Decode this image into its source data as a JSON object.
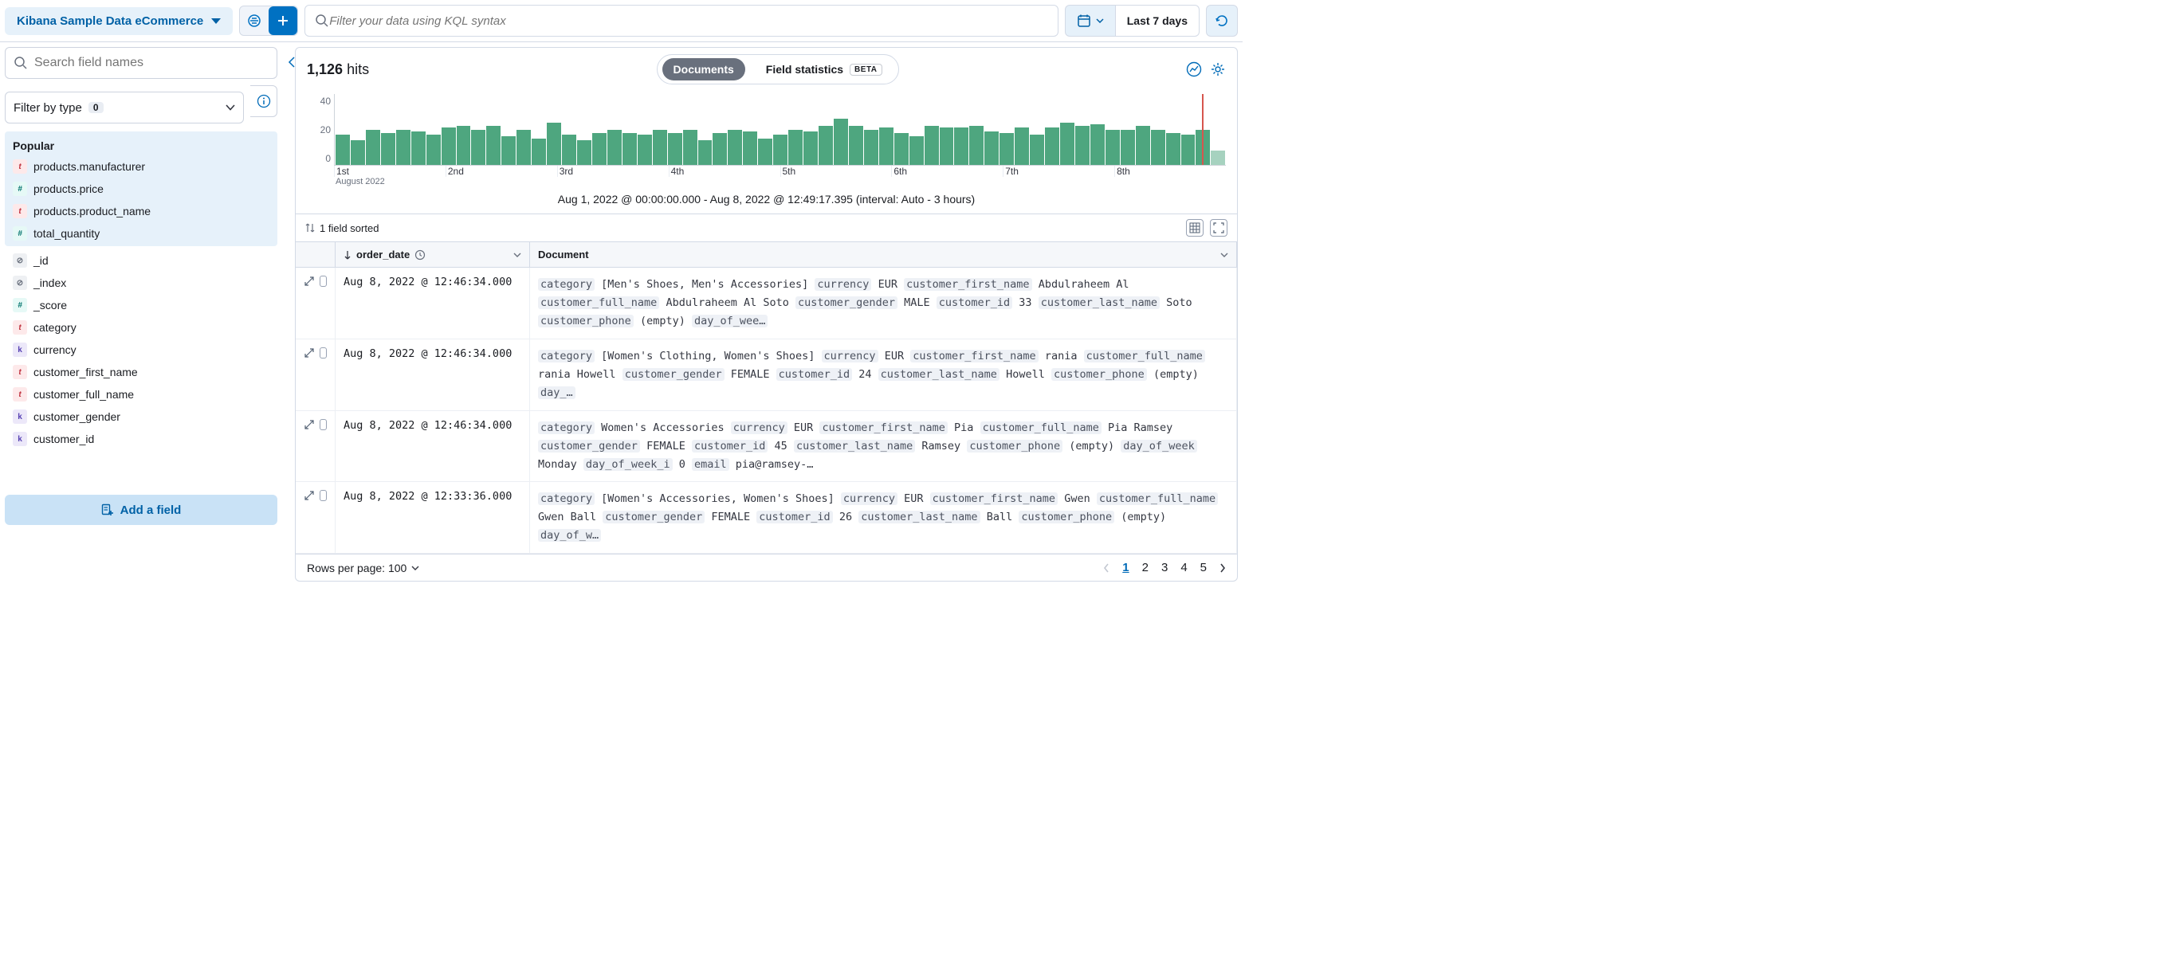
{
  "header": {
    "dataview": "Kibana Sample Data eCommerce",
    "search_placeholder": "Filter your data using KQL syntax",
    "date_range": "Last 7 days"
  },
  "sidebar": {
    "field_search_placeholder": "Search field names",
    "filter_by_type_label": "Filter by type",
    "filter_by_type_count": "0",
    "popular_label": "Popular",
    "popular_fields": [
      {
        "type": "t",
        "name": "products.manufacturer"
      },
      {
        "type": "n",
        "name": "products.price"
      },
      {
        "type": "t",
        "name": "products.product_name"
      },
      {
        "type": "n",
        "name": "total_quantity"
      }
    ],
    "fields": [
      {
        "type": "q",
        "name": "_id"
      },
      {
        "type": "q",
        "name": "_index"
      },
      {
        "type": "n",
        "name": "_score"
      },
      {
        "type": "t",
        "name": "category"
      },
      {
        "type": "k",
        "name": "currency"
      },
      {
        "type": "t",
        "name": "customer_first_name"
      },
      {
        "type": "t",
        "name": "customer_full_name"
      },
      {
        "type": "k",
        "name": "customer_gender"
      },
      {
        "type": "k",
        "name": "customer_id"
      }
    ],
    "add_field_label": "Add a field"
  },
  "main": {
    "hits_count": "1,126",
    "hits_label": "hits",
    "toggle_documents": "Documents",
    "toggle_stats": "Field statistics",
    "beta": "BETA",
    "caption": "Aug 1, 2022 @ 00:00:00.000 - Aug 8, 2022 @ 12:49:17.395 (interval: Auto - 3 hours)",
    "sorted_label": "1 field sorted",
    "col_order_date": "order_date",
    "col_document": "Document",
    "rows_per_page": "Rows per page: 100",
    "pages": [
      "1",
      "2",
      "3",
      "4",
      "5"
    ],
    "current_page": "1"
  },
  "chart_data": {
    "type": "bar",
    "ylim": [
      0,
      40
    ],
    "yticks": [
      40,
      20,
      0
    ],
    "xticks": [
      "1st",
      "2nd",
      "3rd",
      "4th",
      "5th",
      "6th",
      "7th",
      "8th"
    ],
    "x_month": "August 2022",
    "values": [
      17,
      14,
      20,
      18,
      20,
      19,
      17,
      21,
      22,
      20,
      22,
      16,
      20,
      15,
      24,
      17,
      14,
      18,
      20,
      18,
      17,
      20,
      18,
      20,
      14,
      18,
      20,
      19,
      15,
      17,
      20,
      19,
      22,
      26,
      22,
      20,
      21,
      18,
      16,
      22,
      21,
      21,
      22,
      19,
      18,
      21,
      17,
      21,
      24,
      22,
      23,
      20,
      20,
      22,
      20,
      18,
      17,
      20,
      8
    ]
  },
  "rows": [
    {
      "order_date": "Aug 8, 2022 @ 12:46:34.000",
      "doc": [
        {
          "k": "category",
          "v": "[Men's Shoes, Men's Accessories]"
        },
        {
          "k": "currency",
          "v": "EUR"
        },
        {
          "k": "customer_first_name",
          "v": "Abdulraheem Al"
        },
        {
          "k": "customer_full_name",
          "v": "Abdulraheem Al Soto"
        },
        {
          "k": "customer_gender",
          "v": "MALE"
        },
        {
          "k": "customer_id",
          "v": "33"
        },
        {
          "k": "customer_last_name",
          "v": "Soto"
        },
        {
          "k": "customer_phone",
          "v": "(empty)"
        },
        {
          "k": "day_of_wee…",
          "v": ""
        }
      ]
    },
    {
      "order_date": "Aug 8, 2022 @ 12:46:34.000",
      "doc": [
        {
          "k": "category",
          "v": "[Women's Clothing, Women's Shoes]"
        },
        {
          "k": "currency",
          "v": "EUR"
        },
        {
          "k": "customer_first_name",
          "v": "rania"
        },
        {
          "k": "customer_full_name",
          "v": "rania Howell"
        },
        {
          "k": "customer_gender",
          "v": "FEMALE"
        },
        {
          "k": "customer_id",
          "v": "24"
        },
        {
          "k": "customer_last_name",
          "v": "Howell"
        },
        {
          "k": "customer_phone",
          "v": "(empty)"
        },
        {
          "k": "day_…",
          "v": ""
        }
      ]
    },
    {
      "order_date": "Aug 8, 2022 @ 12:46:34.000",
      "doc": [
        {
          "k": "category",
          "v": "Women's Accessories"
        },
        {
          "k": "currency",
          "v": "EUR"
        },
        {
          "k": "customer_first_name",
          "v": "Pia"
        },
        {
          "k": "customer_full_name",
          "v": "Pia Ramsey"
        },
        {
          "k": "customer_gender",
          "v": "FEMALE"
        },
        {
          "k": "customer_id",
          "v": "45"
        },
        {
          "k": "customer_last_name",
          "v": "Ramsey"
        },
        {
          "k": "customer_phone",
          "v": "(empty)"
        },
        {
          "k": "day_of_week",
          "v": "Monday"
        },
        {
          "k": "day_of_week_i",
          "v": "0"
        },
        {
          "k": "email",
          "v": "pia@ramsey-…"
        }
      ]
    },
    {
      "order_date": "Aug 8, 2022 @ 12:33:36.000",
      "doc": [
        {
          "k": "category",
          "v": "[Women's Accessories, Women's Shoes]"
        },
        {
          "k": "currency",
          "v": "EUR"
        },
        {
          "k": "customer_first_name",
          "v": "Gwen"
        },
        {
          "k": "customer_full_name",
          "v": "Gwen Ball"
        },
        {
          "k": "customer_gender",
          "v": "FEMALE"
        },
        {
          "k": "customer_id",
          "v": "26"
        },
        {
          "k": "customer_last_name",
          "v": "Ball"
        },
        {
          "k": "customer_phone",
          "v": "(empty)"
        },
        {
          "k": "day_of_w…",
          "v": ""
        }
      ]
    }
  ]
}
